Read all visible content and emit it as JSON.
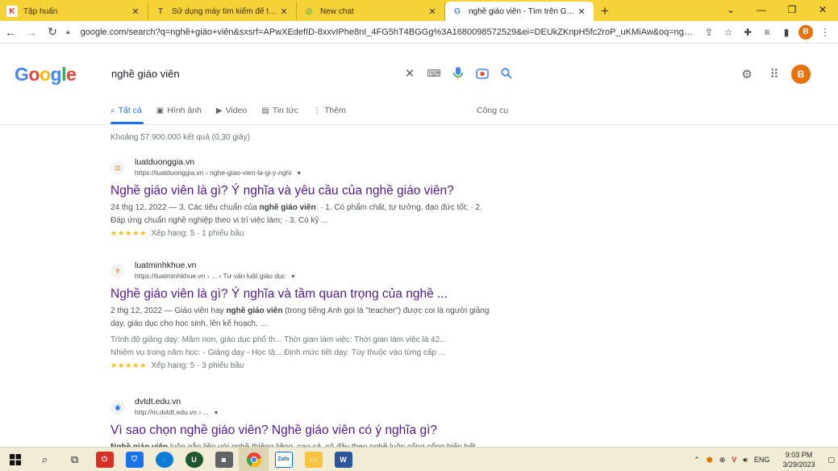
{
  "tabs": [
    {
      "title": "Tập huấn",
      "favicon": "K",
      "favcolor": "#d93025"
    },
    {
      "title": "Sử dụng máy tìm kiếm để tìm hiể",
      "favicon": "T",
      "favcolor": "#5f6368"
    },
    {
      "title": "New chat",
      "favicon": "◎",
      "favcolor": "#10a37f"
    },
    {
      "title": "nghề giáo viên - Tìm trên Google",
      "favicon": "G",
      "favcolor": "#4285f4"
    }
  ],
  "new_tab": "+",
  "window": {
    "dropdown": "⌄",
    "minimize": "—",
    "maximize": "❐",
    "close": "✕"
  },
  "toolbar": {
    "back": "←",
    "forward": "→",
    "reload": "↻",
    "url": "google.com/search?q=nghề+giáo+viên&sxsrf=APwXEdefID-8xxvIPhe8nI_4FG5hT4BGGg%3A1680098572529&ei=DEUkZKnpH5fc2roP_uKMiAw&oq=ng+giáo...",
    "profile_initial": "B"
  },
  "logo": [
    "G",
    "o",
    "o",
    "g",
    "l",
    "e"
  ],
  "logo_colors": [
    "#4285f4",
    "#ea4335",
    "#fbbc05",
    "#4285f4",
    "#34a853",
    "#ea4335"
  ],
  "search": {
    "query": "nghề giáo viên"
  },
  "header": {
    "avatar_initial": "B"
  },
  "filters": [
    {
      "label": "Tất cả",
      "icon": "⌕"
    },
    {
      "label": "Hình ảnh",
      "icon": "▣"
    },
    {
      "label": "Video",
      "icon": "▶"
    },
    {
      "label": "Tin tức",
      "icon": "▤"
    },
    {
      "label": "Thêm",
      "icon": "⋮"
    }
  ],
  "tools_label": "Công cụ",
  "stats": "Khoảng 57.900.000 kết quả (0,30 giây)",
  "results": [
    {
      "site": "luatduonggia.vn",
      "crumb": "https://luatduonggia.vn › nghe-giao-vien-la-gi-y-nghi",
      "title": "Nghề giáo viên là gì? Ý nghĩa và yêu cầu của nghề giáo viên?",
      "snippet_pre": "24 thg 12, 2022 — 3. Các tiêu chuẩn của ",
      "snippet_bold": "nghề giáo viên",
      "snippet_post": ": · 1. Có phẩm chất, tư tưởng, đạo đức tốt; · 2. Đáp ứng chuẩn nghề nghiệp theo vị trí việc làm; · 3. Có kỹ ...",
      "stars": "★★★★★",
      "rating": "Xếp hạng: 5 · 1 phiếu bầu"
    },
    {
      "site": "luatminhkhue.vn",
      "crumb": "https://luatminhkhue.vn › ... › Tư vấn luật giáo dục",
      "title": "Nghề giáo viên là gì? Ý nghĩa và tầm quan trọng của nghề ...",
      "snippet_pre": "2 thg 12, 2022 — Giáo viên hay ",
      "snippet_bold": "nghề giáo viên",
      "snippet_post": " (trong tiếng Anh gọi là \"teacher\") được coi là người giảng dạy, giáo dục cho học sinh, lên kế hoạch, ...",
      "sitelink1": "Trình độ giảng dạy: Mầm non, giáo dục phổ th...    Thời gian làm việc: Thời gian làm việc là 42...",
      "sitelink2": "Nhiệm vụ trong năm học: - Giảng dạy - Học tậ...    Định mức tiết dạy: Tùy thuộc vào từng cấp ...",
      "stars": "★★★★★",
      "rating": "Xếp hạng: 5 · 3 phiếu bầu"
    },
    {
      "site": "dvtdt.edu.vn",
      "crumb": "http://m.dvtdt.edu.vn › ...",
      "title": "Vì sao chọn nghề giáo viên? Nghề giáo viên có ý nghĩa gì?",
      "snippet_pre": "",
      "snippet_bold": "Nghề giáo viên",
      "snippet_post": " luôn gắn liền với nghề thiêng liêng, cao cả, cô đây theo nghề luôn cống cống hiến hết..."
    }
  ],
  "taskbar": {
    "clock_time": "9:03 PM",
    "clock_date": "3/29/2023",
    "lang": "ENG"
  }
}
